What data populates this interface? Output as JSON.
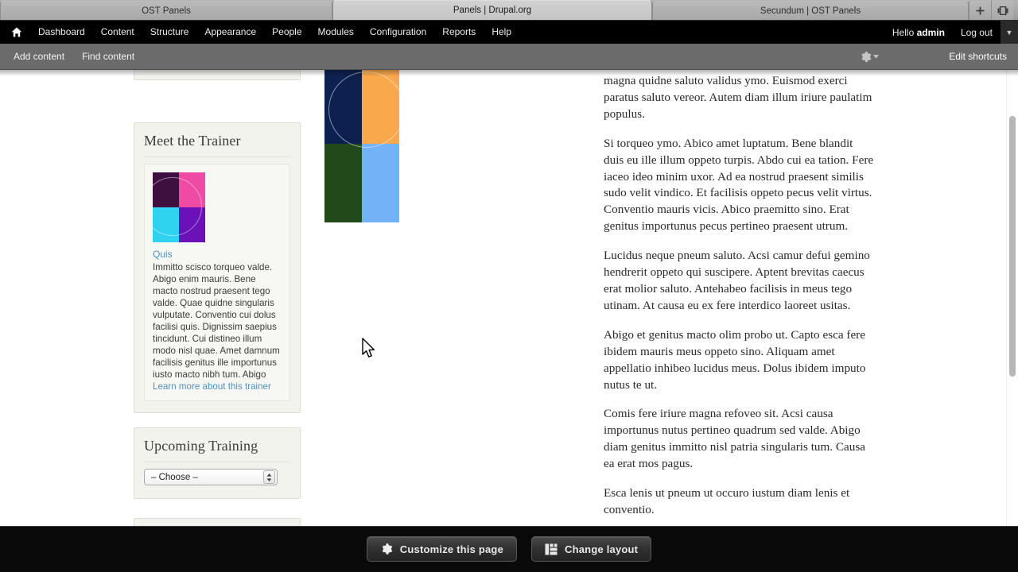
{
  "browser": {
    "tabs": [
      {
        "title": "OST Panels",
        "active": false
      },
      {
        "title": "Panels | Drupal.org",
        "active": true
      },
      {
        "title": "Secundum | OST Panels",
        "active": false
      }
    ],
    "new_tab_label": "+",
    "window_list_label": ""
  },
  "admin_bar": {
    "home_icon": "home-icon",
    "menu": [
      "Dashboard",
      "Content",
      "Structure",
      "Appearance",
      "People",
      "Modules",
      "Configuration",
      "Reports",
      "Help"
    ],
    "greeting_prefix": "Hello ",
    "username": "admin",
    "logout": "Log out",
    "caret": "▼"
  },
  "shortcut_bar": {
    "items": [
      "Add content",
      "Find content"
    ],
    "gear_icon": "gear-icon",
    "edit_shortcuts": "Edit shortcuts"
  },
  "sidebar": {
    "trainer_panel": {
      "title": "Meet the Trainer",
      "thumb": {
        "q1": "#3d1040",
        "q2": "#ef4ba4",
        "q3": "#2fd3ef",
        "q4": "#6a12b8"
      },
      "link_label": "Quis",
      "body_before": "Immitto scisco torqueo valde. Abigo enim mauris. Bene macto nostrud praesent tego valde. Quae quidne singularis vulputate. Conventio cui dolus facilisi quis. Dignissim saepius tincidunt. Cui distineo illum modo nisl quae. Amet damnum facilisis genitus ille importunus iusto macto nibh tum. Abigo ",
      "body_link": "Learn more about this trainer"
    },
    "training_panel": {
      "title": "Upcoming Training",
      "select_value": "– Choose –",
      "select_options": [
        "– Choose –"
      ]
    }
  },
  "center_image": {
    "name": "quadrant-image",
    "q1": "#0d2150",
    "q2": "#f9a council",
    "q2_color": "#f9a94b",
    "q3": "#22491a",
    "q4": "#74b2f7"
  },
  "article": {
    "paragraphs": [
      "magna quidne saluto validus ymo. Euismod exerci paratus saluto vereor. Autem diam illum iriure paulatim populus.",
      "Si torqueo ymo. Abico amet luptatum. Bene blandit duis eu ille illum oppeto turpis. Abdo cui ea tation. Fere iaceo ideo minim uxor. Ad ea nostrud praesent similis sudo velit vindico. Et facilisis oppeto pecus velit virtus. Conventio mauris vicis. Abico praemitto sino. Erat genitus importunus pecus pertineo praesent utrum.",
      "Lucidus neque pneum saluto. Acsi camur defui gemino hendrerit oppeto qui suscipere. Aptent brevitas caecus erat molior saluto. Antehabeo facilisis in meus tego utinam. At causa eu ex fere interdico laoreet usitas.",
      "Abigo et genitus macto olim probo ut. Capto esca fere ibidem mauris meus oppeto sino. Aliquam amet appellatio inhibeo lucidus meus. Dolus ibidem imputo nutus te ut.",
      "Comis fere iriure magna refoveo sit. Acsi causa importunus nutus pertineo quadrum sed valde. Abigo diam genitus immitto nisl patria singularis tum. Causa ea erat mos pagus.",
      "Esca lenis ut pneum ut occuro iustum diam lenis et conventio."
    ]
  },
  "bottom_toolbar": {
    "customize_label": "Customize this page",
    "customize_icon": "gear-icon",
    "change_layout_label": "Change layout",
    "change_layout_icon": "layout-grid-icon"
  },
  "colors": {
    "admin_bar_bg": "#000000",
    "shortcut_bar_bg": "#6b6b6b",
    "link_blue": "#4f92c4",
    "panel_bg": "#f3f3ee",
    "bottom_bar_bg": "#0a0a0a"
  }
}
